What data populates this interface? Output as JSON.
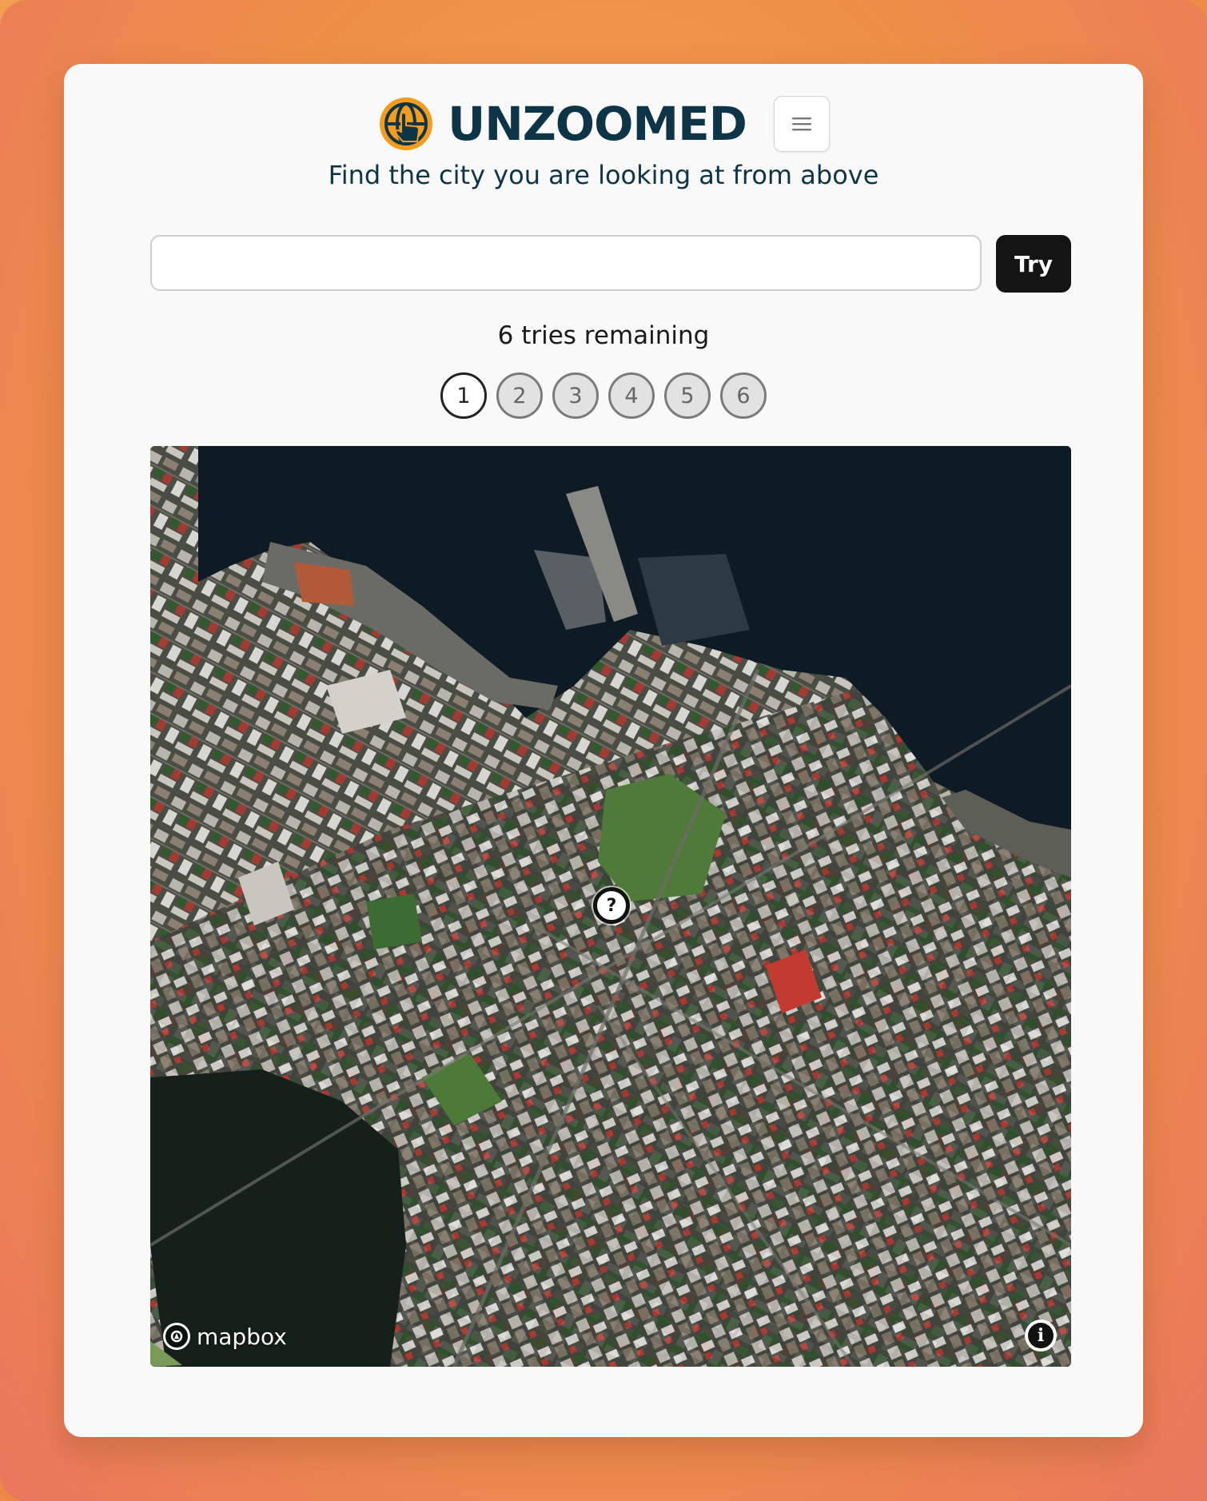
{
  "app": {
    "title": "UNZOOMED",
    "subtitle": "Find the city you are looking at from above",
    "logo_icon": "globe-hand-pointer-icon",
    "menu_icon": "hamburger-menu-icon"
  },
  "guess": {
    "input_value": "",
    "input_placeholder": "",
    "try_label": "Try"
  },
  "status": {
    "tries_text": "6 tries remaining",
    "tries_remaining": 6,
    "steps": [
      "1",
      "2",
      "3",
      "4",
      "5",
      "6"
    ],
    "active_step": 1
  },
  "map": {
    "type": "satellite-image",
    "marker_label": "?",
    "attribution_logo": "mapbox",
    "info_icon": "info-icon"
  },
  "colors": {
    "brand": "#0d3447",
    "accent": "#f39c1e",
    "button": "#141414",
    "background_gradient_start": "#f0a050",
    "background_gradient_end": "#e87a5a"
  }
}
